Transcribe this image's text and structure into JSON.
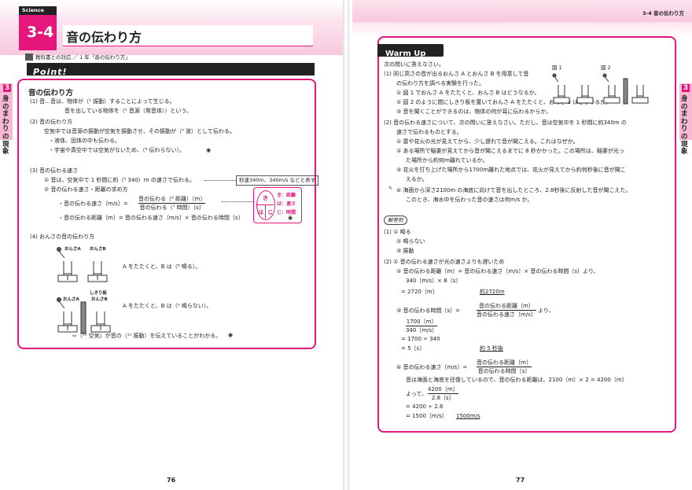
{
  "left": {
    "science_tag": "Science",
    "section_no": "3-4",
    "section_title": "音の伝わり方",
    "textbook_ref": "教科書との対応 ／ 1 年「音の伝わり方」",
    "point_label": "Point!",
    "side_tab": {
      "num": "3",
      "text": "身のまわりの現象"
    },
    "page_no": "76",
    "box_title": "音の伝わり方",
    "lines": [
      "(1)  音…音は、物体が（¹ 振動）することによって生じる。",
      "音を出している物体を（² 音源（発音体））という。",
      "(2)  音の伝わり方",
      "空気中では音源の振動が空気を振動させ、その振動が（³ 波）として伝わる。",
      "・液体、固体の中も伝わる。",
      "・宇宙や真空中では空気がないため、（⁴ 伝わらない）。",
      "(3)  音の伝わる速さ",
      "①  音は、空気中で 1 秒間に約（⁵ 340）m の速さで伝わる。",
      "②  音の伝わる速さ・距離の求め方",
      "・音の伝わる距離〔m〕= 音の伝わる速さ〔m/s〕× 音の伝わる時間〔s〕",
      "(4)  おんさの音の伝わり方",
      "A をたたくと、B は（⁸ 鳴る）。",
      "A をたたくと、B は（⁹ 鳴らない）。",
      "⇨（¹⁰ 空気）が音の（¹¹ 振動）を伝えていることがわかる。"
    ],
    "speed_note": "秒速340m、340m/s などと表す",
    "formula": {
      "lhs": "・音の伝わる速さ〔m/s〕=",
      "num": "音の伝わる（⁶ 距離）〔m〕",
      "den": "音の伝わる（⁷ 時間）〔s〕"
    },
    "kihaji": {
      "k": "き",
      "h": "は",
      "j": "じ",
      "r1": "き：距離",
      "r2": "は：速さ",
      "r3": "じ：時間"
    },
    "fork_labels": {
      "a": "おんさA",
      "b": "おんさB",
      "board": "しきり板"
    }
  },
  "right": {
    "header": "3-4  音の伝わり方",
    "warmup_label": "Warm Up",
    "page_no": "77",
    "fig1": "図 1",
    "fig2": "図 2",
    "side_tab": {
      "num": "3",
      "text": "身のまわりの現象"
    },
    "q_lines": [
      "次の問いに答えなさい。",
      "(1)  同じ高さの音が出るおんさ A とおんさ B を用意して音",
      "の伝わり方を調べる実験を行った。",
      "①  図 1 でおんさ A をたたくと、おんさ B はどうなるか。",
      "②  図 2 のように間にしきり板を置いておんさ A をたたくと、おんさ B はどうなるか。",
      "③  音を聞くことができるのは、物体の何が耳に伝わるからか。",
      "(2)  音の伝わる速さについて、次の問いに答えなさい。ただし、音は空気中を 1 秒間に約340m の",
      "速さで伝わるものとする。",
      "①  雷や花火の光が見えてから、少し遅れて音が聞こえる。これはなぜか。",
      "②  ある場所で稲妻が見えてから音が聞こえるまでに 8 秒かかった。この場所は、稲妻が光っ",
      "た場所から約何m離れているか。",
      "③  花火を打ち上げた場所から1700m離れた地点では、花火が見えてから約何秒後に音が聞こ",
      "えるか。",
      "④  海面から深さ2100m の海底に向けて音を出したところ、2.8秒後に反射した音が聞こえた。",
      "このとき、海水中を伝わった音の速さは何m/s か。"
    ],
    "answer_label": "解答例",
    "a_lines": [
      "(1)  ①  鳴る",
      "②  鳴らない",
      "③  振動",
      "(2)  ①  音の伝わる速さが光の速さよりも遅いため",
      "②  音の伝わる距離〔m〕= 音の伝わる速さ〔m/s〕× 音の伝わる時間〔s〕より、",
      "340〔m/s〕× 8〔s〕",
      "= 2720〔m〕",
      "約2720m",
      "③  音の伝わる時間〔s〕=",
      "より、",
      "= 1700 ÷ 340",
      "= 5〔s〕",
      "約 5 秒後",
      "④  音の伝わる速さ〔m/s〕=",
      "音は海面と海底を往復しているので、音の伝わる距離は、2100〔m〕× 2 = 4200〔m〕",
      "よって、",
      "= 4200 ÷ 2.8",
      "= 1500〔m/s〕",
      "1500m/s"
    ],
    "frac3": {
      "num": "音の伝わる距離〔m〕",
      "den": "音の伝わる速さ〔m/s〕"
    },
    "frac3b": {
      "num": "1700〔m〕",
      "den": "340〔m/s〕"
    },
    "frac4": {
      "num": "音の伝わる距離〔m〕",
      "den": "音の伝わる時間〔s〕"
    },
    "frac4b": {
      "num": "4200〔m〕",
      "den": "2.8〔s〕"
    }
  }
}
